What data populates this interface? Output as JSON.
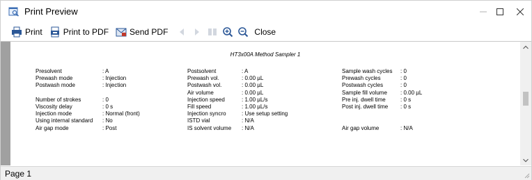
{
  "window": {
    "title": "Print Preview",
    "app_icon": "print-preview-icon"
  },
  "toolbar": {
    "print_label": "Print",
    "print_to_pdf_label": "Print to PDF",
    "send_pdf_label": "Send PDF",
    "close_label": "Close"
  },
  "page": {
    "title": "HT3x00A Method Sampler 1",
    "col1": [
      {
        "k": "Presolvent",
        "v": ": A"
      },
      {
        "k": "Prewash mode",
        "v": ": Injection"
      },
      {
        "k": "Postwash mode",
        "v": ": Injection"
      },
      {
        "k": "",
        "v": ""
      },
      {
        "k": "Number of strokes",
        "v": ": 0"
      },
      {
        "k": "Viscosity delay",
        "v": ": 0 s"
      },
      {
        "k": "Injection mode",
        "v": ": Normal (front)"
      },
      {
        "k": "Using internal standard",
        "v": ": No"
      },
      {
        "k": "Air gap mode",
        "v": ": Post"
      }
    ],
    "col2": [
      {
        "k": "Postsolvent",
        "v": ": A"
      },
      {
        "k": "Prewash vol.",
        "v": ": 0.00 µL"
      },
      {
        "k": "Postwash vol.",
        "v": ": 0.00 µL"
      },
      {
        "k": "Air volume",
        "v": ": 0.00 µL"
      },
      {
        "k": "Injection speed",
        "v": ": 1.00 µL/s"
      },
      {
        "k": "Fill speed",
        "v": ": 1.00 µL/s"
      },
      {
        "k": "Injection syncro",
        "v": ": Use setup setting"
      },
      {
        "k": "ISTD vial",
        "v": ": N/A"
      },
      {
        "k": "IS solvent volume",
        "v": ": N/A"
      }
    ],
    "col3": [
      {
        "k": "Sample wash cycles",
        "v": ": 0"
      },
      {
        "k": "Prewash cycles",
        "v": ": 0"
      },
      {
        "k": "Postwash cycles",
        "v": ": 0"
      },
      {
        "k": "Sample fill volume",
        "v": ": 0.00 µL"
      },
      {
        "k": "Pre inj. dwell time",
        "v": ": 0 s"
      },
      {
        "k": "Post inj. dwell time",
        "v": ": 0 s"
      },
      {
        "k": "",
        "v": ""
      },
      {
        "k": "",
        "v": ""
      },
      {
        "k": "Air gap volume",
        "v": ": N/A"
      }
    ]
  },
  "status": {
    "page_label": "Page 1"
  },
  "colors": {
    "preview_bg": "#a0a0a0",
    "toolbar_icon_blue": "#2b5797",
    "zoom_green": "#3a8f3a",
    "pdf_red": "#c0392b"
  }
}
